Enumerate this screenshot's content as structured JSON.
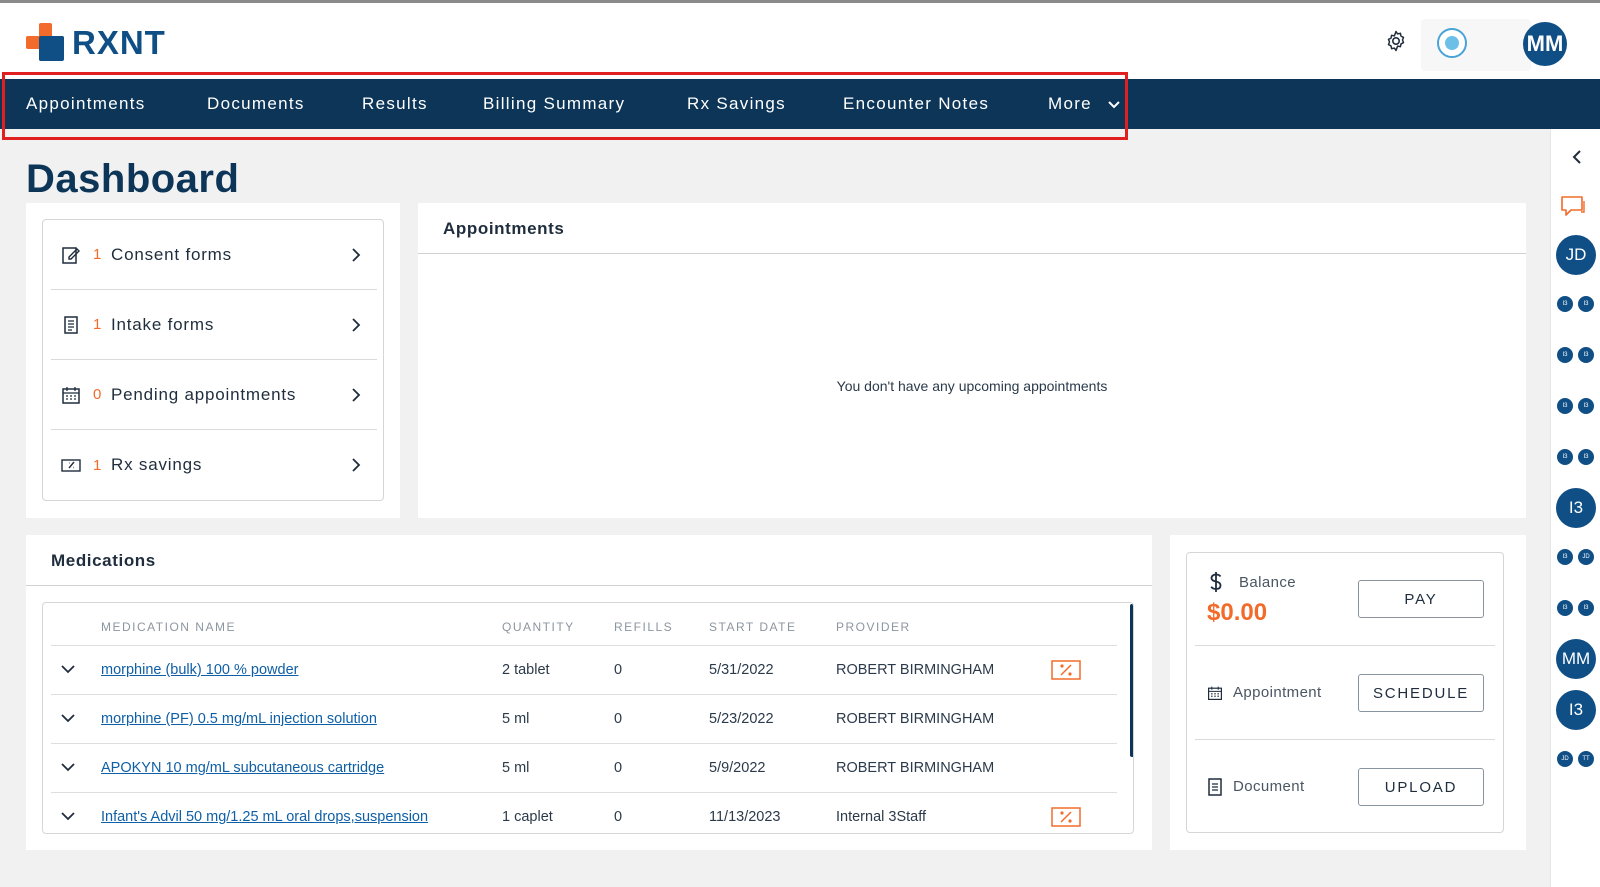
{
  "app": {
    "brand": "RXNT"
  },
  "header": {
    "user_initials": "MM"
  },
  "nav": {
    "items": [
      {
        "label": "Appointments"
      },
      {
        "label": "Documents"
      },
      {
        "label": "Results"
      },
      {
        "label": "Billing Summary"
      },
      {
        "label": "Rx Savings"
      },
      {
        "label": "Encounter Notes"
      },
      {
        "label": "More"
      }
    ]
  },
  "page": {
    "title": "Dashboard"
  },
  "summary": {
    "items": [
      {
        "count": "1",
        "label": "Consent forms",
        "icon": "edit-form-icon"
      },
      {
        "count": "1",
        "label": "Intake forms",
        "icon": "clipboard-icon"
      },
      {
        "count": "0",
        "label": "Pending appointments",
        "icon": "calendar-icon"
      },
      {
        "count": "1",
        "label": "Rx savings",
        "icon": "coupon-icon"
      }
    ]
  },
  "appointments": {
    "title": "Appointments",
    "empty_message": "You don't have any upcoming appointments"
  },
  "medications": {
    "title": "Medications",
    "columns": [
      "MEDICATION NAME",
      "QUANTITY",
      "REFILLS",
      "START DATE",
      "PROVIDER"
    ],
    "rows": [
      {
        "name": "morphine (bulk) 100 % powder",
        "quantity": "2 tablet",
        "refills": "0",
        "start_date": "5/31/2022",
        "provider": "ROBERT BIRMINGHAM",
        "has_coupon": true
      },
      {
        "name": "morphine (PF) 0.5 mg/mL injection solution",
        "quantity": "5 ml",
        "refills": "0",
        "start_date": "5/23/2022",
        "provider": "ROBERT BIRMINGHAM",
        "has_coupon": false
      },
      {
        "name": "APOKYN 10 mg/mL subcutaneous cartridge",
        "quantity": "5 ml",
        "refills": "0",
        "start_date": "5/9/2022",
        "provider": "ROBERT BIRMINGHAM",
        "has_coupon": false
      },
      {
        "name": "Infant's Advil 50 mg/1.25 mL oral drops,suspension",
        "quantity": "1 caplet",
        "refills": "0",
        "start_date": "11/13/2023",
        "provider": "Internal 3Staff",
        "has_coupon": true
      }
    ]
  },
  "payments": {
    "balance_label": "Balance",
    "balance_amount": "$0.00",
    "pay_button": "PAY",
    "appointment_label": "Appointment",
    "schedule_button": "SCHEDULE",
    "document_label": "Document",
    "upload_button": "UPLOAD"
  },
  "side_panel": {
    "avatars": [
      {
        "kind": "large",
        "label": "JD"
      },
      {
        "kind": "pair",
        "labels": [
          "I3",
          "I3"
        ]
      },
      {
        "kind": "pair",
        "labels": [
          "I3",
          "I3"
        ]
      },
      {
        "kind": "pair",
        "labels": [
          "I3",
          "I3"
        ]
      },
      {
        "kind": "pair",
        "labels": [
          "I3",
          "I3"
        ]
      },
      {
        "kind": "large",
        "label": "I3"
      },
      {
        "kind": "pair",
        "labels": [
          "I3",
          "JD"
        ]
      },
      {
        "kind": "pair",
        "labels": [
          "I3",
          "I3"
        ]
      },
      {
        "kind": "large",
        "label": "MM"
      },
      {
        "kind": "large",
        "label": "I3"
      },
      {
        "kind": "pair",
        "labels": [
          "JD",
          "TT"
        ]
      }
    ]
  },
  "colors": {
    "primary": "#0c3558",
    "brand_blue": "#0f4f86",
    "accent": "#f26b2a",
    "highlight": "#e02020"
  }
}
